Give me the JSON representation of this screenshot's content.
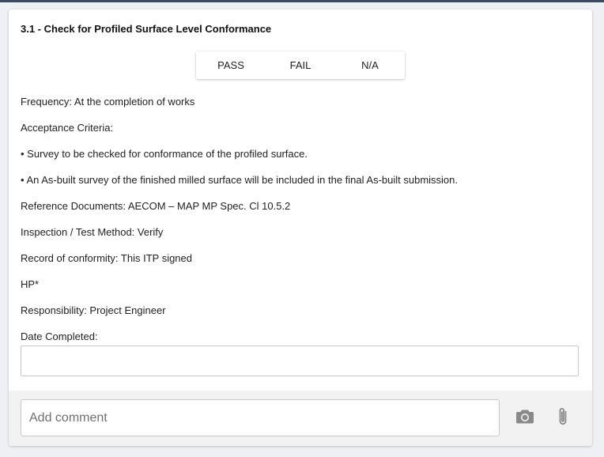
{
  "card": {
    "title": "3.1 - Check for Profiled Surface Level Conformance"
  },
  "status_options": {
    "pass": "PASS",
    "fail": "FAIL",
    "na": "N/A"
  },
  "details": {
    "frequency": "Frequency: At the completion of works",
    "acceptance_heading": "Acceptance Criteria:",
    "criteria_1": "• Survey to be checked for conformance of the profiled surface.",
    "criteria_2": "• An As-built survey of the finished milled surface will be included in the final As-built submission.",
    "reference_documents": "Reference Documents: AECOM – MAP MP Spec. Cl 10.5.2",
    "inspection_method": "Inspection / Test Method: Verify",
    "record_of_conformity": "Record of conformity: This ITP signed",
    "hold_point": "HP*",
    "responsibility": "Responsibility: Project Engineer",
    "date_completed_label": "Date Completed:"
  },
  "date_completed": {
    "value": ""
  },
  "comment": {
    "placeholder": "Add comment",
    "value": ""
  },
  "icons": {
    "camera": "camera-icon",
    "attachment": "paperclip-icon"
  },
  "colors": {
    "icon_gray": "#8a8a8a",
    "footer_bg": "#f2f2f2",
    "header_bar": "#3e4a5e"
  }
}
